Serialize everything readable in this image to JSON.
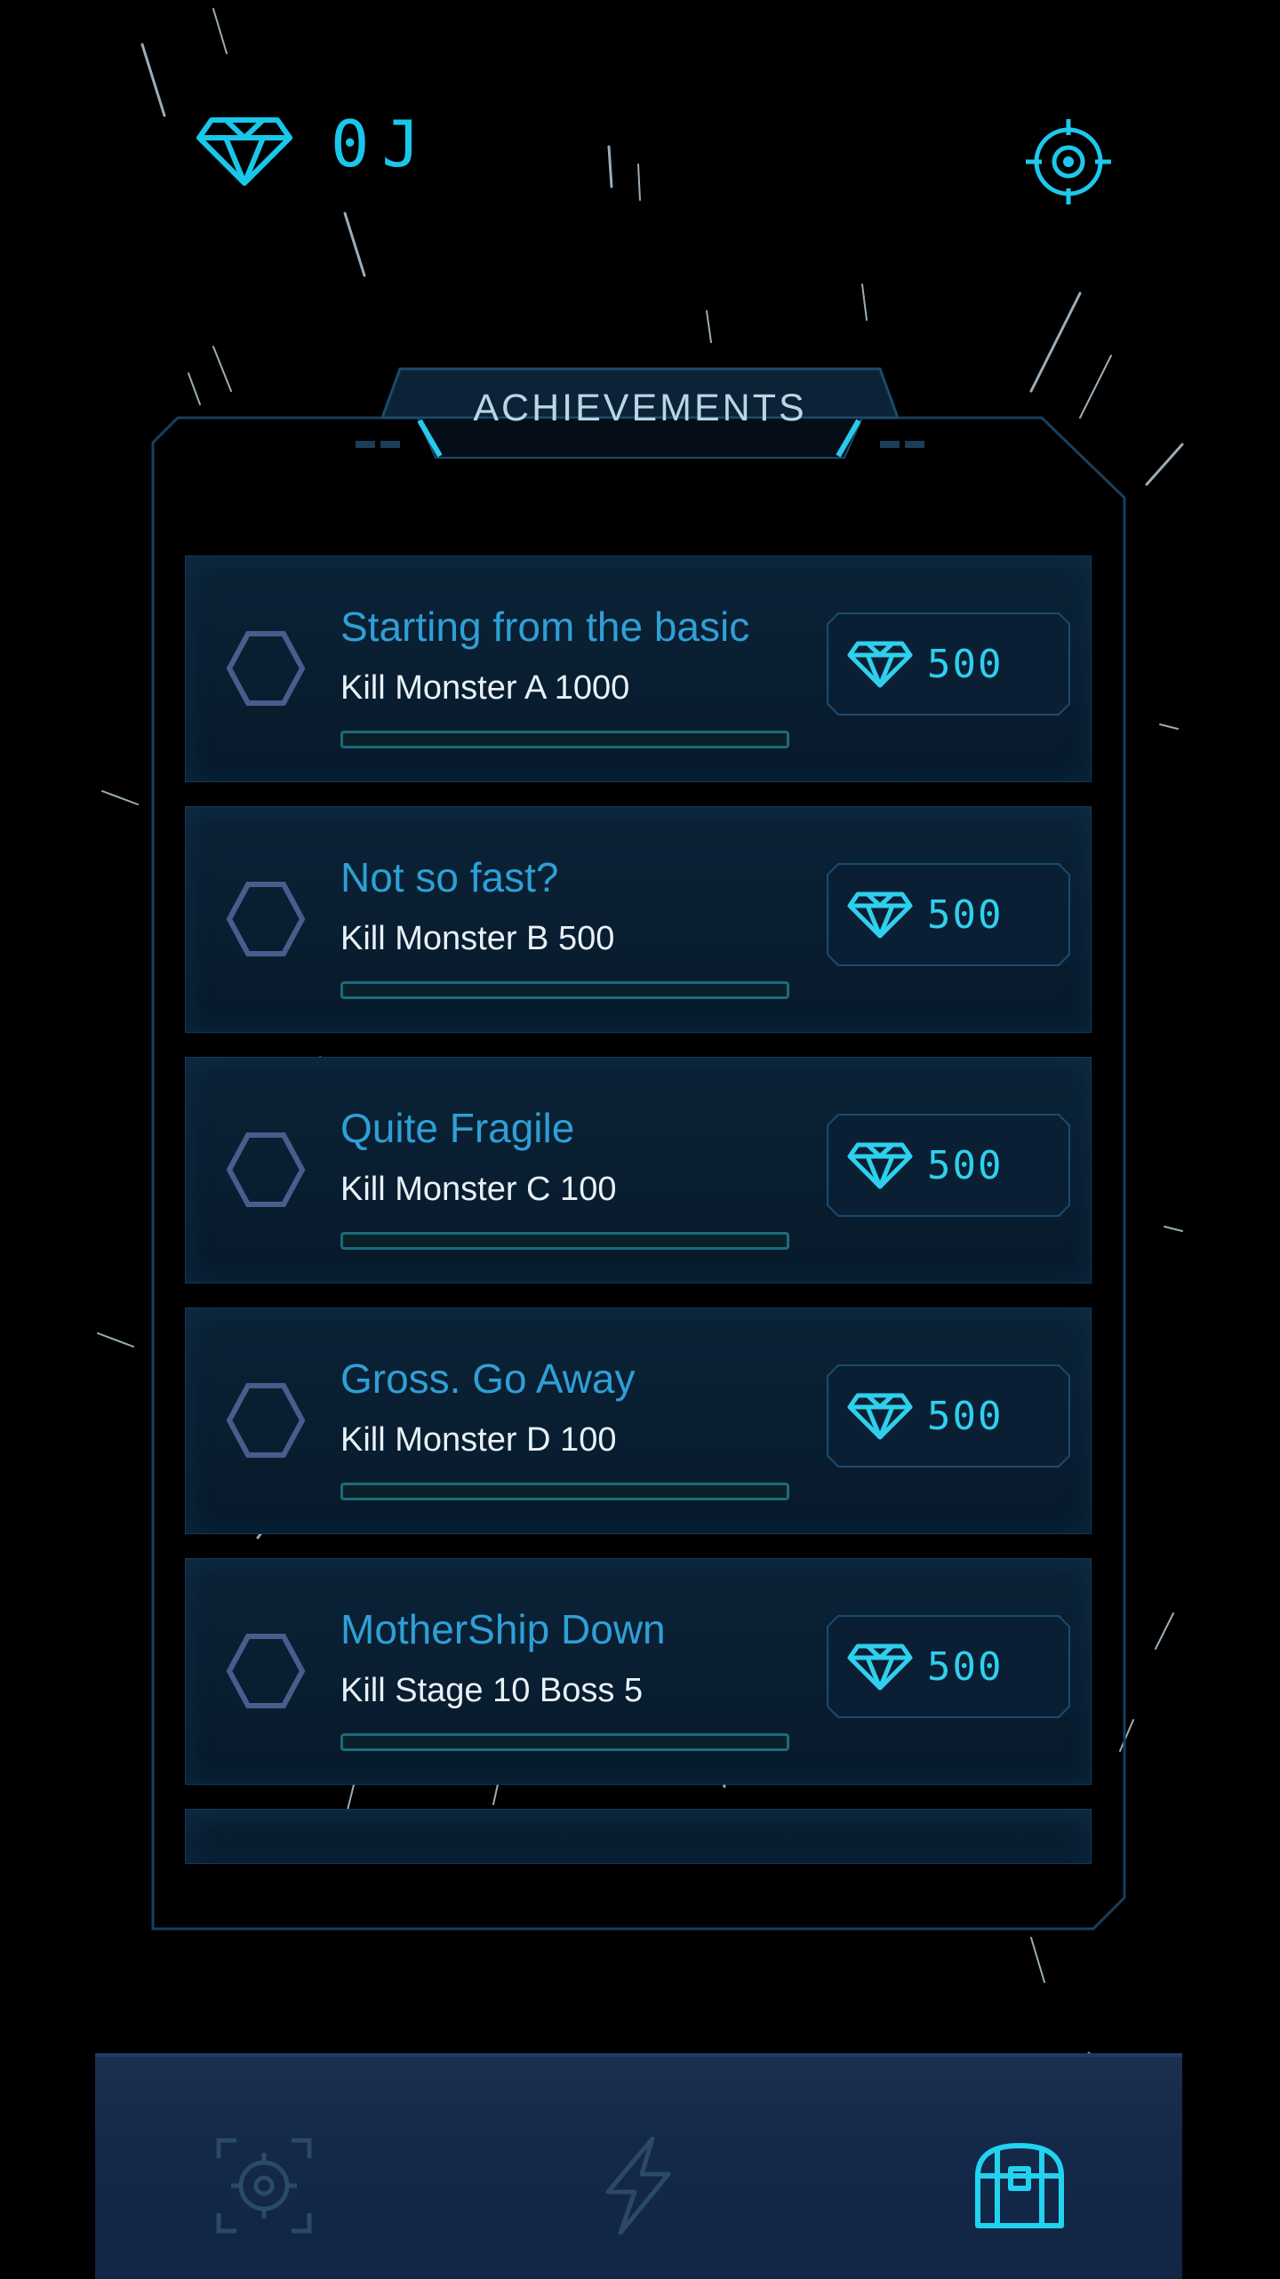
{
  "header": {
    "currency_value": "0J",
    "currency_icon": "diamond-icon",
    "settings_icon": "target-gear-icon"
  },
  "panel": {
    "title": "ACHIEVEMENTS"
  },
  "achievements": [
    {
      "title": "Starting from the basic",
      "description": "Kill Monster A 1000",
      "reward": "500",
      "progress": 0
    },
    {
      "title": "Not so fast?",
      "description": "Kill Monster B 500",
      "reward": "500",
      "progress": 0
    },
    {
      "title": "Quite Fragile",
      "description": "Kill Monster C 100",
      "reward": "500",
      "progress": 0
    },
    {
      "title": "Gross. Go Away",
      "description": "Kill Monster D 100",
      "reward": "500",
      "progress": 0
    },
    {
      "title": "MotherShip Down",
      "description": "Kill Stage 10 Boss 5",
      "reward": "500",
      "progress": 0
    }
  ],
  "bottom_nav": {
    "items": [
      {
        "icon": "crosshair-icon",
        "active": false
      },
      {
        "icon": "lightning-icon",
        "active": false
      },
      {
        "icon": "treasure-chest-icon",
        "active": true
      }
    ]
  },
  "colors": {
    "accent": "#19c7ea",
    "title_blue": "#2f9fd6",
    "card_bg": "#0b2236",
    "nav_bg": "#1b2f4e",
    "inactive_icon": "#2a4a66"
  }
}
